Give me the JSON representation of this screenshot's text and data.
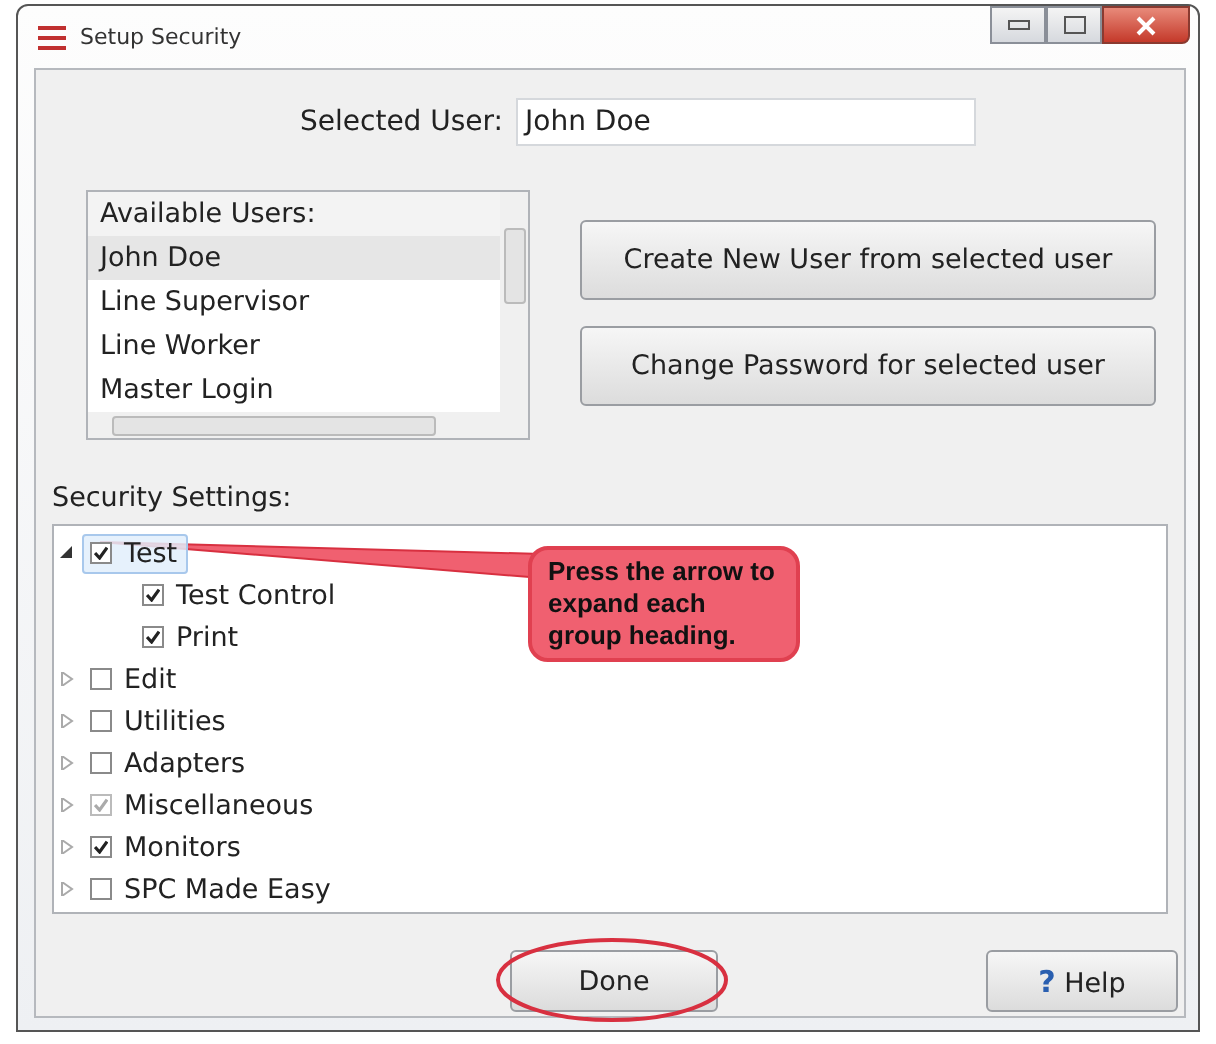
{
  "window": {
    "title": "Setup Security"
  },
  "selected_user": {
    "label": "Selected User:",
    "value": "John Doe"
  },
  "users_list": {
    "header": "Available Users:",
    "items": [
      {
        "name": "John Doe",
        "selected": true
      },
      {
        "name": "Line Supervisor",
        "selected": false
      },
      {
        "name": "Line Worker",
        "selected": false
      },
      {
        "name": "Master Login",
        "selected": false
      }
    ]
  },
  "buttons": [
    {
      "label": "Create New User from selected user"
    },
    {
      "label": "Change Password for selected user"
    }
  ],
  "security_settings": {
    "label": "Security Settings:",
    "tree": [
      {
        "label": "Test",
        "checked": true,
        "partial": false,
        "expanded": true,
        "selected": true,
        "children": [
          {
            "label": "Test Control",
            "checked": true,
            "partial": false,
            "selected": false
          },
          {
            "label": "Print",
            "checked": true,
            "partial": false,
            "selected": false
          }
        ]
      },
      {
        "label": "Edit",
        "checked": false,
        "partial": false,
        "expanded": false,
        "selected": false
      },
      {
        "label": "Utilities",
        "checked": false,
        "partial": false,
        "expanded": false,
        "selected": false
      },
      {
        "label": "Adapters",
        "checked": false,
        "partial": false,
        "expanded": false,
        "selected": false
      },
      {
        "label": "Miscellaneous",
        "checked": true,
        "partial": true,
        "expanded": false,
        "selected": false
      },
      {
        "label": "Monitors",
        "checked": true,
        "partial": false,
        "expanded": false,
        "selected": false
      },
      {
        "label": "SPC Made Easy",
        "checked": false,
        "partial": false,
        "expanded": false,
        "selected": false
      }
    ]
  },
  "callout": {
    "text": "Press the arrow to expand each group heading."
  },
  "footer": {
    "done": "Done",
    "help_icon": "?",
    "help": "Help"
  }
}
